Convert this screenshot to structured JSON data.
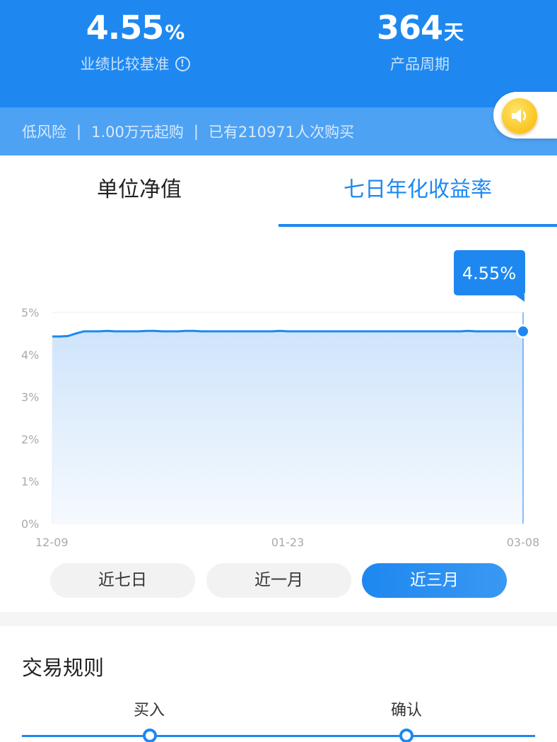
{
  "header": {
    "benchmark": {
      "value": "4.55",
      "unit": "%",
      "label": "业绩比较基准",
      "info_glyph": "!"
    },
    "period": {
      "value": "364",
      "unit": "天",
      "label": "产品周期"
    }
  },
  "summary": {
    "risk": "低风险",
    "separator": "|",
    "min_purchase": "1.00万元起购",
    "purchases": "已有210971人次购买"
  },
  "tabs": [
    {
      "label": "单位净值",
      "active": false
    },
    {
      "label": "七日年化收益率",
      "active": true
    }
  ],
  "chart_data": {
    "type": "area",
    "title": "",
    "xlabel": "",
    "ylabel": "",
    "x_ticks": [
      "12-09",
      "01-23",
      "03-08"
    ],
    "y_ticks": [
      "5%",
      "4%",
      "3%",
      "2%",
      "1%",
      "0%"
    ],
    "ylim": [
      0,
      5
    ],
    "grid": true,
    "series": [
      {
        "values": [
          4.43,
          4.43,
          4.44,
          4.5,
          4.55,
          4.55,
          4.55,
          4.56,
          4.55,
          4.55,
          4.55,
          4.55,
          4.56,
          4.56,
          4.55,
          4.55,
          4.55,
          4.56,
          4.56,
          4.55,
          4.55,
          4.55,
          4.55,
          4.55,
          4.55,
          4.55,
          4.55,
          4.55,
          4.55,
          4.56,
          4.55,
          4.55,
          4.55,
          4.55,
          4.55,
          4.55,
          4.55,
          4.55,
          4.55,
          4.55,
          4.55,
          4.55,
          4.55,
          4.55,
          4.55,
          4.55,
          4.55,
          4.55,
          4.55,
          4.55,
          4.55,
          4.55,
          4.55,
          4.56,
          4.55,
          4.55,
          4.55,
          4.55,
          4.55,
          4.55,
          4.55
        ]
      }
    ],
    "callout": "4.55%",
    "colors": {
      "line": "#1e88f0",
      "fill_top": "#cfe4fb",
      "fill_bottom": "#f6fafe",
      "grid": "#eeeeee",
      "tick": "#aaaaaa",
      "callout_bg": "#1e88f0"
    }
  },
  "ranges": [
    {
      "label": "近七日",
      "active": false
    },
    {
      "label": "近一月",
      "active": false
    },
    {
      "label": "近三月",
      "active": true
    }
  ],
  "rules": {
    "title": "交易规则",
    "steps": [
      "买入",
      "确认"
    ]
  },
  "icons": {
    "speaker": "speaker-icon",
    "info": "info-icon"
  },
  "colors": {
    "brand": "#1e88f0",
    "strip": "#4ea2f3"
  }
}
